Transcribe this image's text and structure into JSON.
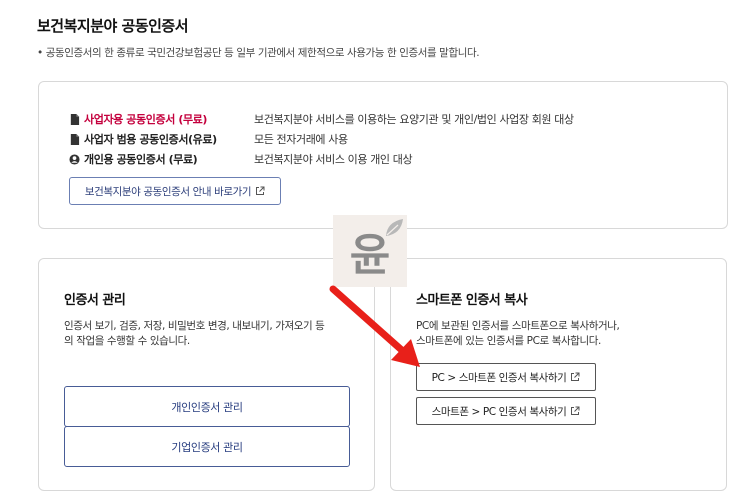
{
  "page": {
    "title": "보건복지분야 공동인증서",
    "description": "• 공동인증서의 한 종류로 국민건강보험공단 등 일부 기관에서 제한적으로 사용가능 한 인증서를 말합니다."
  },
  "certificates": [
    {
      "name": "사업자용 공동인증서 (무료)",
      "desc": "보건복지분야 서비스를 이용하는 요양기관 및 개인/법인 사업장 회원 대상",
      "icon": "document-icon"
    },
    {
      "name": "사업자 범용 공동인증서(유료)",
      "desc": "모든 전자거래에 사용",
      "icon": "document-icon"
    },
    {
      "name": "개인용 공동인증서 (무료)",
      "desc": "보건복지분야 서비스 이용 개인 대상",
      "icon": "person-icon"
    }
  ],
  "guide_button": {
    "label": "보건복지분야 공동인증서 안내 바로가기"
  },
  "cert_management": {
    "title": "인증서 관리",
    "desc_line1": "인증서 보기, 검증, 저장, 비밀번호 변경, 내보내기, 가져오기 등",
    "desc_line2": "의 작업을 수행할 수 있습니다.",
    "personal_button": "개인인증서 관리",
    "corporate_button": "기업인증서 관리"
  },
  "smartphone_copy": {
    "title": "스마트폰 인증서 복사",
    "desc_line1": "PC에 보관된 인증서를 스마트폰으로 복사하거나,",
    "desc_line2": "스마트폰에 있는 인증서를 PC로 복사합니다.",
    "pc_to_phone_button": "PC > 스마트폰 인증서 복사하기",
    "phone_to_pc_button": "스마트폰 > PC 인증서 복사하기"
  },
  "watermark": {
    "char": "윤"
  },
  "colors": {
    "highlight": "#c4003d",
    "button_border": "#485c96",
    "arrow": "#e8201a"
  }
}
